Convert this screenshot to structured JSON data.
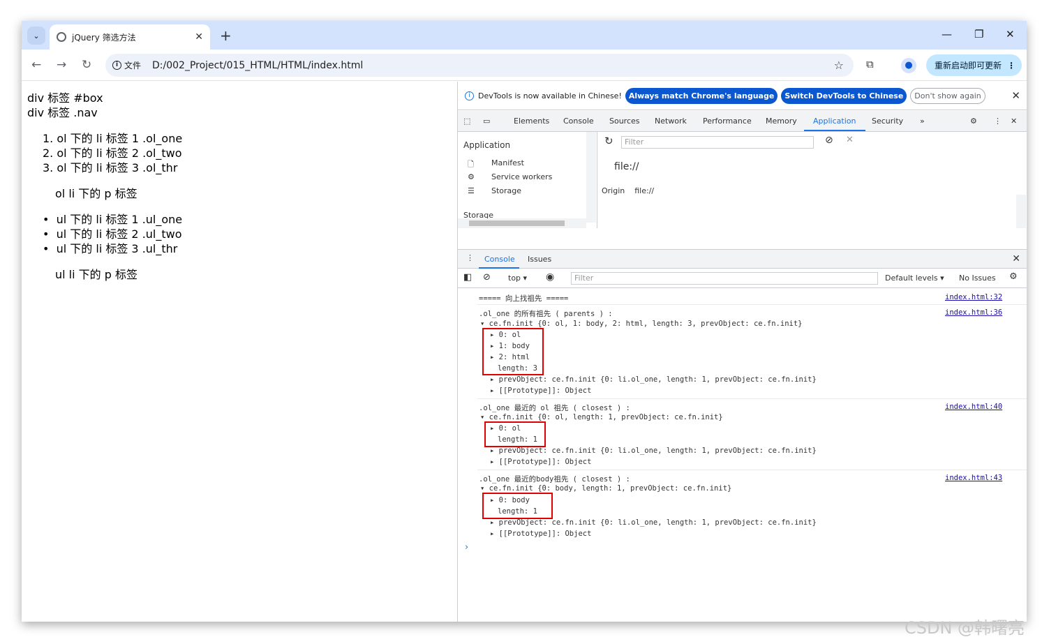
{
  "browser": {
    "tab_title": "jQuery 筛选方法",
    "address": "D:/002_Project/015_HTML/HTML/index.html",
    "chip_label": "文件",
    "update_label": "重新启动即可更新"
  },
  "page": {
    "lines": [
      "div 标签 #box",
      "div 标签 .nav"
    ],
    "ol_items": [
      "1. ol 下的 li 标签 1 .ol_one",
      "2. ol 下的 li 标签 2 .ol_two",
      "3. ol 下的 li 标签 3 .ol_thr"
    ],
    "ol_p": "ol li 下的 p 标签",
    "ul_items": [
      "ul 下的 li 标签 1 .ul_one",
      "ul 下的 li 标签 2 .ul_two",
      "ul 下的 li 标签 3 .ul_thr"
    ],
    "ul_p": "ul li 下的 p 标签"
  },
  "devtools": {
    "info_text": "DevTools is now available in Chinese!",
    "btn_match": "Always match Chrome's language",
    "btn_switch": "Switch DevTools to Chinese",
    "btn_dont": "Don't show again",
    "tabs": [
      "Elements",
      "Console",
      "Sources",
      "Network",
      "Performance",
      "Memory",
      "Application",
      "Security"
    ],
    "app_heading": "Application",
    "app_items": [
      "Manifest",
      "Service workers",
      "Storage"
    ],
    "storage_label": "Storage",
    "filter_placeholder": "Filter",
    "file_url": "file://",
    "origin_label": "Origin",
    "origin_value": "file://",
    "drawer_console": "Console",
    "drawer_issues": "Issues",
    "context": "top",
    "default_levels": "Default levels",
    "no_issues": "No Issues"
  },
  "console": {
    "header": "===== 向上找祖先 =====",
    "header_link": "index.html:32",
    "g1_title": ".ol_one 的所有祖先 ( parents ) :",
    "g1_link": "index.html:36",
    "g1_summary": "ce.fn.init {0: ol, 1: body, 2: html, length: 3, prevObject: ce.fn.init}",
    "g1_items": [
      "0: ol",
      "1: body",
      "2: html"
    ],
    "g1_length": "length: 3",
    "prev": "prevObject: ce.fn.init {0: li.ol_one, length: 1, prevObject: ce.fn.init}",
    "proto": "[[Prototype]]: Object",
    "g2_title": ".ol_one 最近的 ol 祖先 ( closest ) :",
    "g2_link": "index.html:40",
    "g2_summary": "ce.fn.init {0: ol, length: 1, prevObject: ce.fn.init}",
    "g2_item": "0: ol",
    "g2_length": "length: 1",
    "g3_title": ".ol_one 最近的body祖先 ( closest ) :",
    "g3_link": "index.html:43",
    "g3_summary": "ce.fn.init {0: body, length: 1, prevObject: ce.fn.init}",
    "g3_item": "0: body",
    "g3_length": "length: 1"
  },
  "watermark": "CSDN @韩曙亮"
}
